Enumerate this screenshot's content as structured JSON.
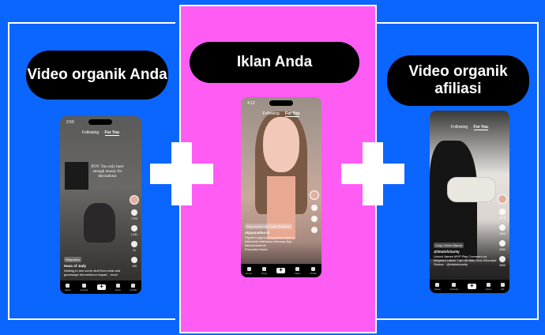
{
  "labels": {
    "left": "Video organik Anda",
    "center": "Iklan Anda",
    "right": "Video organik afiliasi"
  },
  "phones": {
    "left": {
      "time": "2:59",
      "tabs": [
        "Following",
        "For You"
      ],
      "overlay": "POV: You only have enough money for decorations",
      "tag": "Requestor",
      "user": "Haus of Jady",
      "caption": "Waiting to see some stuff from what and giveaways #homedecor #apart... more",
      "counts": [
        "770K",
        "1,911",
        "21",
        "105"
      ],
      "nav": [
        "Home",
        "Friends",
        "",
        "Inbox",
        "Profile"
      ]
    },
    "center": {
      "time": "4:12",
      "tabs": [
        "Following",
        "For You"
      ],
      "tag": "Repurchase the Lotus Essence",
      "user": "skyparadise.id",
      "caption": "Pigment pigment bag toast makeup influencer #skincare #beauty #fyp #tiktokmademe",
      "sound": "Promoted Music",
      "nav": [
        "Home",
        "Shop",
        "",
        "Inbox",
        "Profile"
      ]
    },
    "right": {
      "tabs": [
        "Following",
        "For You"
      ],
      "tag": "Cosy Clutch Mama",
      "user": "@bitalofcharity",
      "caption": "Linked James MVP Play Comment on #bigarea Latest: I am #A Bitty Scot #Scented",
      "sound": "Stroker - @bitalofcharity",
      "counts": [
        "26.0k",
        "1803",
        "3450",
        "3550"
      ],
      "nav": [
        "Home",
        "Friends",
        "",
        "Inbox",
        "Me"
      ]
    }
  }
}
